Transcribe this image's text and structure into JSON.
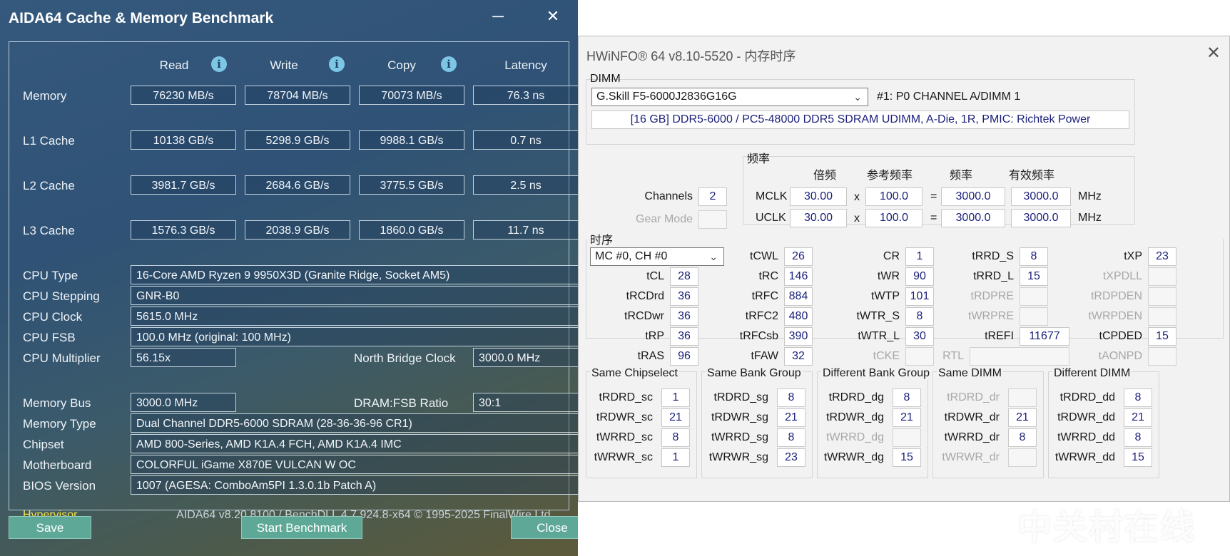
{
  "aida": {
    "title": "AIDA64 Cache & Memory Benchmark",
    "minimize": "─",
    "close": "✕",
    "info_glyph": "i",
    "columns": [
      "Read",
      "Write",
      "Copy",
      "Latency"
    ],
    "rows": [
      {
        "label": "Memory",
        "values": [
          "76230 MB/s",
          "78704 MB/s",
          "70073 MB/s",
          "76.3 ns"
        ]
      },
      {
        "label": "L1 Cache",
        "values": [
          "10138 GB/s",
          "5298.9 GB/s",
          "9988.1 GB/s",
          "0.7 ns"
        ]
      },
      {
        "label": "L2 Cache",
        "values": [
          "3981.7 GB/s",
          "2684.6 GB/s",
          "3775.5 GB/s",
          "2.5 ns"
        ]
      },
      {
        "label": "L3 Cache",
        "values": [
          "1576.3 GB/s",
          "2038.9 GB/s",
          "1860.0 GB/s",
          "11.7 ns"
        ]
      }
    ],
    "cpu_type_label": "CPU Type",
    "cpu_type": "16-Core AMD Ryzen 9 9950X3D  (Granite Ridge, Socket AM5)",
    "cpu_stepping_label": "CPU Stepping",
    "cpu_stepping": "GNR-B0",
    "cpu_clock_label": "CPU Clock",
    "cpu_clock": "5615.0 MHz",
    "cpu_fsb_label": "CPU FSB",
    "cpu_fsb": "100.0 MHz  (original: 100 MHz)",
    "cpu_mult_label": "CPU Multiplier",
    "cpu_mult": "56.15x",
    "nb_clock_label": "North Bridge Clock",
    "nb_clock": "3000.0 MHz",
    "mem_bus_label": "Memory Bus",
    "mem_bus": "3000.0 MHz",
    "dram_ratio_label": "DRAM:FSB Ratio",
    "dram_ratio": "30:1",
    "mem_type_label": "Memory Type",
    "mem_type": "Dual Channel DDR5-6000 SDRAM  (28-36-36-96 CR1)",
    "chipset_label": "Chipset",
    "chipset": "AMD 800-Series, AMD K1A.4 FCH, AMD K1A.4 IMC",
    "mobo_label": "Motherboard",
    "mobo": "COLORFUL iGame X870E VULCAN W OC",
    "bios_label": "BIOS Version",
    "bios": "1007  (AGESA: ComboAm5PI 1.3.0.1b Patch A)",
    "hypervisor": "Hypervisor",
    "footer": "AIDA64 v8.20.8100 / BenchDLL 4.7.924.8-x64  © 1995-2025 FinalWire Ltd.",
    "btn_save": "Save",
    "btn_start": "Start Benchmark",
    "btn_close": "Close"
  },
  "hw": {
    "title": "HWiNFO® 64 v8.10-5520 - 内存时序",
    "close": "✕",
    "dimm_label": "DIMM",
    "dimm_select": "G.Skill F5-6000J2836G16G",
    "dimm_slot": "#1: P0 CHANNEL A/DIMM 1",
    "dimm_desc": "[16 GB] DDR5-6000 / PC5-48000 DDR5 SDRAM UDIMM, A-Die, 1R, PMIC: Richtek Power",
    "freq_label": "频率",
    "freq_headers": [
      "倍频",
      "参考频率",
      "频率",
      "有效频率"
    ],
    "channels_label": "Channels",
    "channels": "2",
    "gear_label": "Gear Mode",
    "mclk_label": "MCLK",
    "mclk": [
      "30.00",
      "100.0",
      "3000.0",
      "3000.0"
    ],
    "uclk_label": "UCLK",
    "uclk": [
      "30.00",
      "100.0",
      "3000.0",
      "3000.0"
    ],
    "x_sym": "x",
    "eq_sym": "=",
    "mhz": "MHz",
    "timing_label": "时序",
    "mc_select": "MC #0, CH #0",
    "t": {
      "tCL": "28",
      "tRCDrd": "36",
      "tRCDwr": "36",
      "tRP": "36",
      "tRAS": "96",
      "tCWL": "26",
      "tRC": "146",
      "tRFC": "884",
      "tRFC2": "480",
      "tRFCsb": "390",
      "tFAW": "32",
      "CR": "1",
      "tWR": "90",
      "tWTP": "101",
      "tWTR_S": "8",
      "tWTR_L": "30",
      "tRRD_S": "8",
      "tRRD_L": "15",
      "tREFI": "11677",
      "tXP": "23",
      "tCPDED": "15"
    },
    "tl": {
      "tCL": "tCL",
      "tRCDrd": "tRCDrd",
      "tRCDwr": "tRCDwr",
      "tRP": "tRP",
      "tRAS": "tRAS",
      "tCWL": "tCWL",
      "tRC": "tRC",
      "tRFC": "tRFC",
      "tRFC2": "tRFC2",
      "tRFCsb": "tRFCsb",
      "tFAW": "tFAW",
      "CR": "CR",
      "tWR": "tWR",
      "tWTP": "tWTP",
      "tWTR_S": "tWTR_S",
      "tWTR_L": "tWTR_L",
      "tCKE": "tCKE",
      "tRRD_S": "tRRD_S",
      "tRRD_L": "tRRD_L",
      "tRDPRE": "tRDPRE",
      "tWRPRE": "tWRPRE",
      "tREFI": "tREFI",
      "RTL": "RTL",
      "tXP": "tXP",
      "tXPDLL": "tXPDLL",
      "tRDPDEN": "tRDPDEN",
      "tWRPDEN": "tWRPDEN",
      "tCPDED": "tCPDED",
      "tAONPD": "tAONPD"
    },
    "groups": [
      {
        "title": "Same Chipselect",
        "rows": [
          [
            "tRDRD_sc",
            "1"
          ],
          [
            "tRDWR_sc",
            "21"
          ],
          [
            "tWRRD_sc",
            "8"
          ],
          [
            "tWRWR_sc",
            "1"
          ]
        ]
      },
      {
        "title": "Same Bank Group",
        "rows": [
          [
            "tRDRD_sg",
            "8"
          ],
          [
            "tRDWR_sg",
            "21"
          ],
          [
            "tWRRD_sg",
            "8"
          ],
          [
            "tWRWR_sg",
            "23"
          ]
        ]
      },
      {
        "title": "Different Bank Group",
        "rows": [
          [
            "tRDRD_dg",
            "8"
          ],
          [
            "tRDWR_dg",
            "21"
          ],
          [
            "tWRRD_dg",
            ""
          ],
          [
            "tWRWR_dg",
            "15"
          ]
        ]
      },
      {
        "title": "Same DIMM",
        "rows": [
          [
            "tRDRD_dr",
            ""
          ],
          [
            "tRDWR_dr",
            "21"
          ],
          [
            "tWRRD_dr",
            "8"
          ],
          [
            "tWRWR_dr",
            ""
          ]
        ]
      },
      {
        "title": "Different DIMM",
        "rows": [
          [
            "tRDRD_dd",
            "8"
          ],
          [
            "tRDWR_dd",
            "21"
          ],
          [
            "tWRRD_dd",
            "8"
          ],
          [
            "tWRWR_dd",
            "15"
          ]
        ]
      }
    ]
  },
  "watermark": {
    "text": "中关村在线",
    "logo": "zol-logo"
  }
}
